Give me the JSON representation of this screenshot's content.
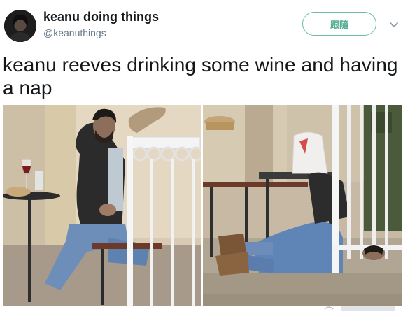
{
  "tweet": {
    "display_name": "keanu doing things",
    "handle": "@keanuthings",
    "follow_label": "跟隨",
    "text": "keanu reeves drinking some wine and having a nap"
  },
  "icons": {
    "more": "chevron-down-icon"
  },
  "colors": {
    "follow_accent": "#58ad95",
    "text": "#14171a",
    "secondary_text": "#657786"
  }
}
